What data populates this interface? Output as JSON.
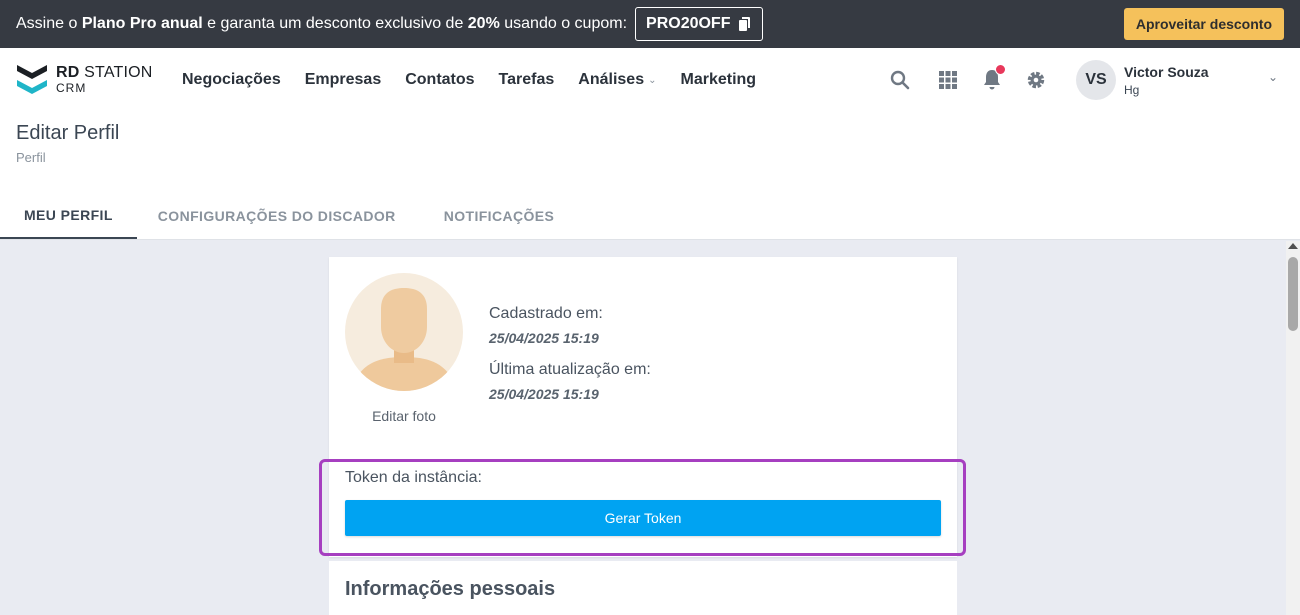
{
  "promo": {
    "text_1": "Assine o ",
    "text_bold_1": "Plano Pro anual",
    "text_2": " e garanta um desconto exclusivo de ",
    "text_bold_2": "20%",
    "text_3": " usando o cupom:",
    "coupon": "PRO20OFF",
    "copy_icon": "copy-icon",
    "cta": "Aproveitar desconto"
  },
  "nav": {
    "logo_line1_bold": "RD",
    "logo_line1_rest": " STATION",
    "logo_line2": "CRM",
    "menu": [
      "Negociações",
      "Empresas",
      "Contatos",
      "Tarefas",
      "Análises",
      "Marketing"
    ],
    "icons": [
      "search-icon",
      "apps-grid-icon",
      "bell-icon",
      "gear-icon"
    ],
    "user": {
      "initials": "VS",
      "name": "Victor Souza",
      "org": "Hg"
    }
  },
  "page": {
    "title": "Editar Perfil",
    "breadcrumb": "Perfil",
    "tabs": [
      "MEU PERFIL",
      "CONFIGURAÇÕES DO DISCADOR",
      "NOTIFICAÇÕES"
    ],
    "active_tab": "MEU PERFIL"
  },
  "profile": {
    "edit_photo": "Editar foto",
    "registered_label": "Cadastrado em:",
    "registered_value": "25/04/2025 15:19",
    "updated_label": "Última atualização em:",
    "updated_value": "25/04/2025 15:19",
    "token_label": "Token da instância:",
    "token_button": "Gerar Token",
    "section_title": "Informações pessoais"
  },
  "colors": {
    "promo_bg": "#363a42",
    "promo_cta": "#f5c15b",
    "primary_button": "#00a3f2",
    "highlight": "#a63fc0",
    "notification_dot": "#e8385b"
  }
}
